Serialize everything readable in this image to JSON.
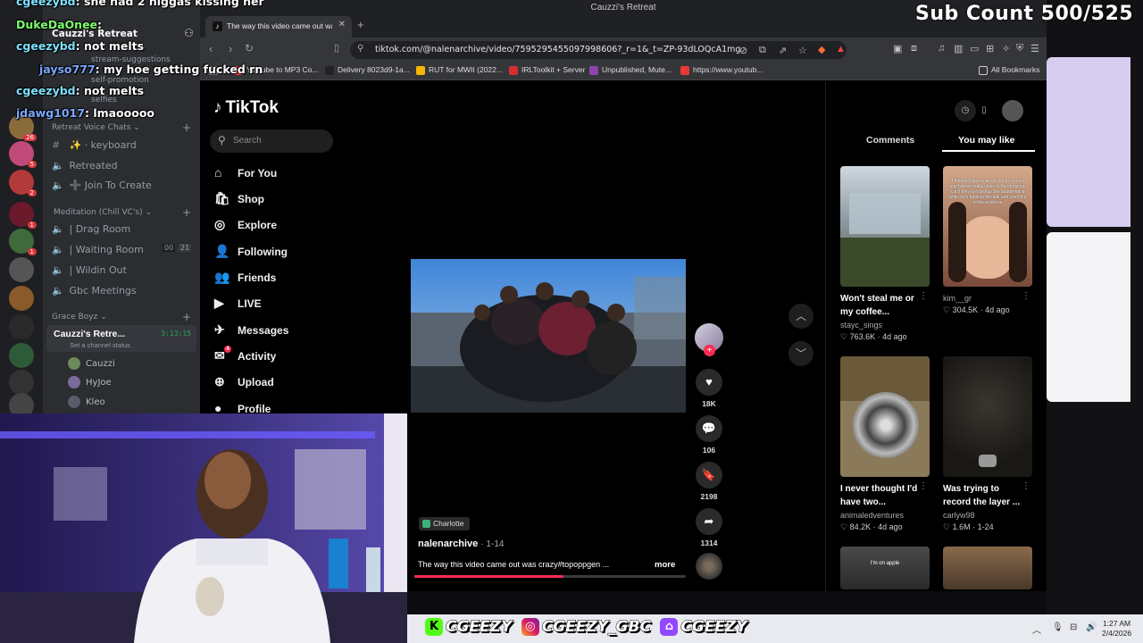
{
  "window_title": "Cauzzi's Retreat",
  "stream_overlay": {
    "sub_count": "Sub Count 500/525",
    "socials": [
      {
        "platform": "kick",
        "handle": "CGEEZY"
      },
      {
        "platform": "instagram",
        "handle": "CGEEZY_GBC"
      },
      {
        "platform": "twitch",
        "handle": "CGEEZY"
      }
    ]
  },
  "chat": [
    {
      "user": "cgeezybd",
      "text": "she had 2 niggas kissing her"
    },
    {
      "user": "DukeDaOnee",
      "text": ""
    },
    {
      "user": "cgeezybd",
      "text": "not melts"
    },
    {
      "user": "jayso777",
      "text": "my hoe getting fucked rn"
    },
    {
      "user": "cgeezybd",
      "text": "not melts"
    },
    {
      "user": "jdawg1017",
      "text": "lmaooooo"
    }
  ],
  "discord": {
    "server_name": "Cauzzi's Retreat",
    "channels_top": [
      "stream-suggestions",
      "self-promotion",
      "selfies"
    ],
    "category_1": "Retreat Voice Chats",
    "voice_1": [
      {
        "icon": "text",
        "name": "✨ · keyboard"
      },
      {
        "icon": "speaker",
        "name": "Retreated"
      },
      {
        "icon": "speaker",
        "name": "➕ Join To Create"
      }
    ],
    "category_2": "Meditation (Chill VC's)",
    "voice_2": [
      {
        "name": "| Drag Room"
      },
      {
        "name": "| Waiting Room",
        "count_a": "00",
        "count_b": "21"
      },
      {
        "name": "| Wildin Out"
      },
      {
        "name": "Gbc Meetings"
      }
    ],
    "category_3": "Grace Boyz",
    "active_vc": {
      "name": "Cauzzi's Retre...",
      "timer": "3:13:15",
      "status": "Set a channel status"
    },
    "vc_users": [
      "Cauzzi",
      "HyJoe",
      "Kleo"
    ],
    "server_badges": [
      "26",
      "5",
      "2",
      "1",
      "1",
      "1"
    ]
  },
  "browser": {
    "tab_title": "The way this video came out wa",
    "url": "tiktok.com/@nalenarchive/video/7595295455097998606?_r=1&_t=ZP-93dLOQcA1mg",
    "bookmarks": [
      "Youtube to MP3 Co...",
      "Delivery 8023d9-1a...",
      "RUT for MWII (2022...",
      "IRLToolkit + Server",
      "Unpublished, Mute...",
      "https://www.youtub..."
    ],
    "all_bookmarks": "All Bookmarks"
  },
  "tiktok": {
    "logo": "TikTok",
    "search_placeholder": "Search",
    "nav": [
      {
        "icon": "home-icon",
        "glyph": "⌂",
        "label": "For You"
      },
      {
        "icon": "shop-icon",
        "glyph": "🛍",
        "label": "Shop"
      },
      {
        "icon": "compass-icon",
        "glyph": "◎",
        "label": "Explore"
      },
      {
        "icon": "following-icon",
        "glyph": "👤",
        "label": "Following"
      },
      {
        "icon": "friends-icon",
        "glyph": "👥",
        "label": "Friends"
      },
      {
        "icon": "live-icon",
        "glyph": "▶",
        "label": "LIVE"
      },
      {
        "icon": "messages-icon",
        "glyph": "✈",
        "label": "Messages"
      },
      {
        "icon": "activity-icon",
        "glyph": "✉",
        "label": "Activity",
        "badge": "4"
      },
      {
        "icon": "upload-icon",
        "glyph": "⊕",
        "label": "Upload"
      },
      {
        "icon": "profile-icon",
        "glyph": "●",
        "label": "Profile"
      }
    ],
    "video": {
      "location": "Charlotte",
      "author": "nalenarchive",
      "date": "· 1-14",
      "caption": "The way this video came out was crazy#topoppgen ...",
      "more": "more",
      "progress": 0.55,
      "likes": "18K",
      "comments": "106",
      "saves": "2198",
      "shares": "1314"
    },
    "panel_tabs": [
      "Comments",
      "You may like"
    ],
    "recommendations": [
      {
        "title": "Won't steal me or my coffee...",
        "author": "stayc_sings",
        "likes": "763.6K",
        "age": "4d ago"
      },
      {
        "title": "",
        "author": "kim__gr",
        "likes": "304.5K",
        "age": "4d ago",
        "thumb_text": "If football players are trying to score a touchdown really close to the endzone can't they just pickup the quarterback while he's holding the ball and yeet him to the endzone"
      },
      {
        "title": "I never thought I'd have two...",
        "author": "animaledventures",
        "likes": "84.2K",
        "age": "4d ago"
      },
      {
        "title": "Was trying to record the layer ...",
        "author": "carlyw98",
        "likes": "1.6M",
        "age": "1-24"
      },
      {
        "title": "",
        "author": "",
        "likes": "",
        "age": "",
        "thumb_text": "I'm on apple"
      },
      {
        "title": "",
        "author": "",
        "likes": "",
        "age": ""
      }
    ]
  },
  "taskbar": {
    "time": "1:27 AM",
    "date": "2/4/2026"
  }
}
